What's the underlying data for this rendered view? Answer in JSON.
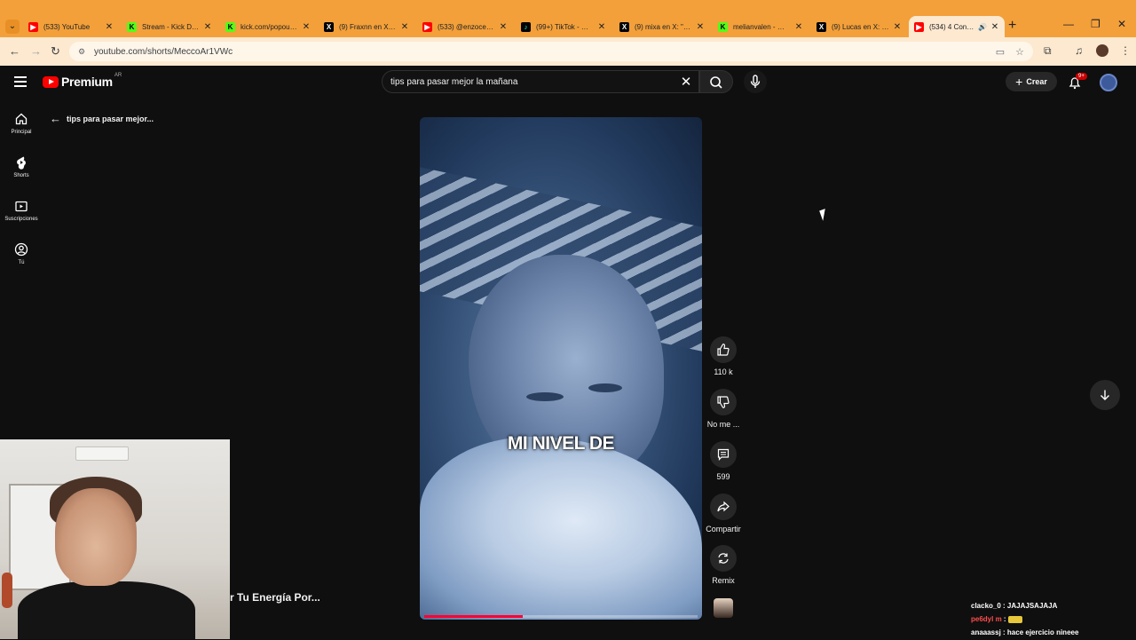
{
  "browser": {
    "tabs": [
      {
        "title": "(533) YouTube",
        "icon": "youtube-favicon",
        "active": false
      },
      {
        "title": "Stream - Kick Da…",
        "icon": "kick-favicon",
        "active": false
      },
      {
        "title": "kick.com/popout…",
        "icon": "kick-favicon",
        "active": false
      },
      {
        "title": "(9) Fraxnn en X: \"…",
        "icon": "x-favicon",
        "active": false
      },
      {
        "title": "(533) @enzocero…",
        "icon": "youtube-favicon",
        "active": false
      },
      {
        "title": "(99+) TikTok - Ma…",
        "icon": "tiktok-favicon",
        "active": false
      },
      {
        "title": "(9) mixa en X: \"el…",
        "icon": "x-favicon",
        "active": false
      },
      {
        "title": "melianvalen - Wa…",
        "icon": "kick-favicon",
        "active": false
      },
      {
        "title": "(9) Lucas en X: \"El…",
        "icon": "x-favicon",
        "active": false
      },
      {
        "title": "(534) 4 Conse…",
        "icon": "youtube-favicon",
        "active": true
      }
    ],
    "url": "youtube.com/shorts/MeccoAr1VWc",
    "accent": "#f3a03a"
  },
  "header": {
    "logo_text": "Premium",
    "country_code": "AR",
    "search_value": "tips para pasar mejor la mañana",
    "create_label": "Crear",
    "notification_badge": "9+"
  },
  "guide": [
    {
      "label": "Principal",
      "icon": "home-icon"
    },
    {
      "label": "Shorts",
      "icon": "shorts-icon"
    },
    {
      "label": "Suscripciones",
      "icon": "subscriptions-icon"
    },
    {
      "label": "Tú",
      "icon": "you-icon"
    }
  ],
  "back_title": "tips para pasar mejor...",
  "video": {
    "caption": "MI NIVEL DE",
    "progress_percent": 36
  },
  "actions": {
    "like_count": "110 k",
    "dislike_label": "No me ...",
    "comment_count": "599",
    "share_label": "Compartir",
    "remix_label": "Remix"
  },
  "partial_title": "r Tu Energía Por...",
  "chat": [
    {
      "user": "clacko_0",
      "message": "JAJAJSAJAJA",
      "color": "#ffffff"
    },
    {
      "user": "pe6dyl m",
      "message": "",
      "emote": true,
      "color": "#ff4d4d"
    },
    {
      "user": "anaaassj",
      "message": "hace ejercicio nineee",
      "color": "#ffffff"
    }
  ]
}
